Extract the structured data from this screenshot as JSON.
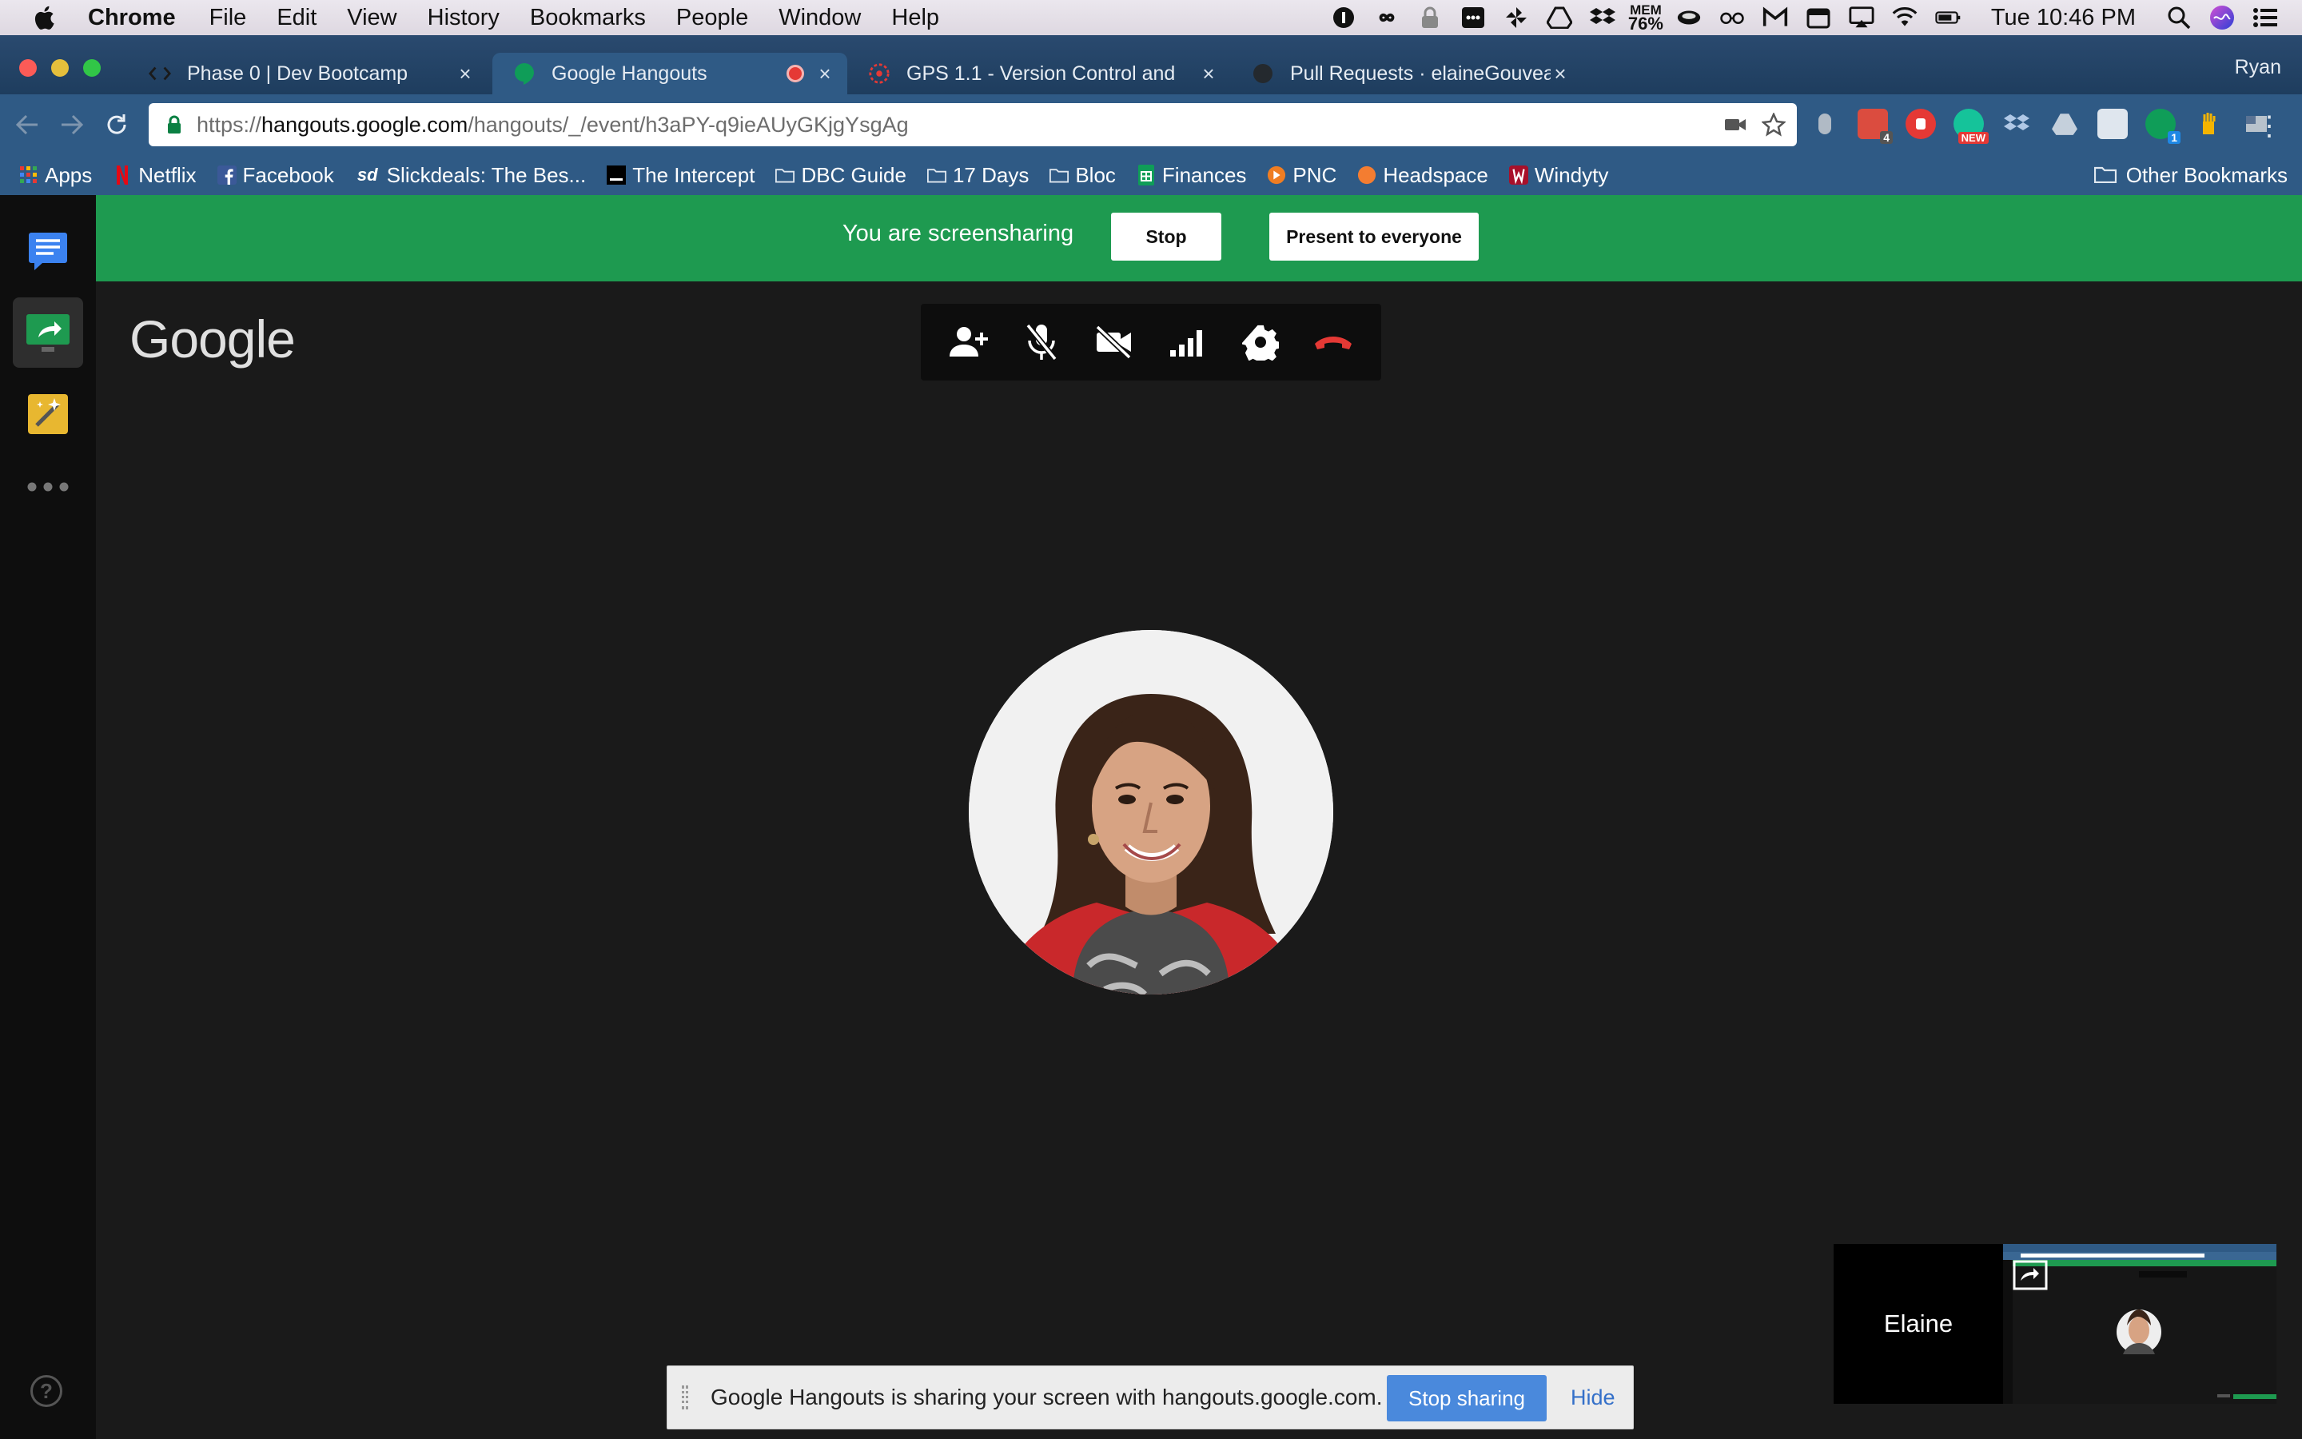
{
  "menubar": {
    "app_name": "Chrome",
    "items": [
      "File",
      "Edit",
      "View",
      "History",
      "Bookmarks",
      "People",
      "Window",
      "Help"
    ],
    "mem_label": "MEM",
    "mem_value": "76%",
    "clock": "Tue 10:46 PM"
  },
  "tabs": [
    {
      "title": "Phase 0 | Dev Bootcamp",
      "icon": "code-icon"
    },
    {
      "title": "Google Hangouts",
      "icon": "hangouts-icon",
      "recording": true
    },
    {
      "title": "GPS 1.1 - Version Control and",
      "icon": "dbc-icon"
    },
    {
      "title": "Pull Requests · elaineGouvea/p",
      "icon": "github-icon"
    }
  ],
  "profile_name": "Ryan",
  "omnibox": {
    "scheme": "https://",
    "host": "hangouts.google.com",
    "path": "/hangouts/_/event/h3aPY-q9ieAUyGKjgYsgAg"
  },
  "extensions": {
    "badge_count": "4",
    "badge_new": "NEW",
    "badge_one": "1"
  },
  "bookmarks": [
    {
      "label": "Apps",
      "icon": "apps-grid-icon"
    },
    {
      "label": "Netflix",
      "icon": "netflix-icon"
    },
    {
      "label": "Facebook",
      "icon": "facebook-icon"
    },
    {
      "label": "Slickdeals: The Bes...",
      "icon": "slickdeals-icon"
    },
    {
      "label": "The Intercept",
      "icon": "intercept-icon"
    },
    {
      "label": "DBC Guide",
      "icon": "folder-icon"
    },
    {
      "label": "17 Days",
      "icon": "folder-icon"
    },
    {
      "label": "Bloc",
      "icon": "folder-icon"
    },
    {
      "label": "Finances",
      "icon": "sheets-icon"
    },
    {
      "label": "PNC",
      "icon": "pnc-icon"
    },
    {
      "label": "Headspace",
      "icon": "headspace-icon"
    },
    {
      "label": "Windyty",
      "icon": "windyty-icon"
    }
  ],
  "other_bookmarks": "Other Bookmarks",
  "share_bar": {
    "text": "You are screensharing",
    "stop": "Stop",
    "present": "Present to everyone"
  },
  "google_logo": "Google",
  "call_controls": [
    "add-person-icon",
    "mic-off-icon",
    "camera-off-icon",
    "signal-icon",
    "settings-icon",
    "hang-up-icon"
  ],
  "filmstrip": {
    "participant": "Elaine"
  },
  "notification": {
    "text": "Google Hangouts is sharing your screen with hangouts.google.com.",
    "stop_sharing": "Stop sharing",
    "hide": "Hide"
  },
  "colors": {
    "share_green": "#1e9a50",
    "chrome_blue": "#2f5a85",
    "hang_up_red": "#e53935",
    "stop_sharing_blue": "#4a89dc"
  }
}
